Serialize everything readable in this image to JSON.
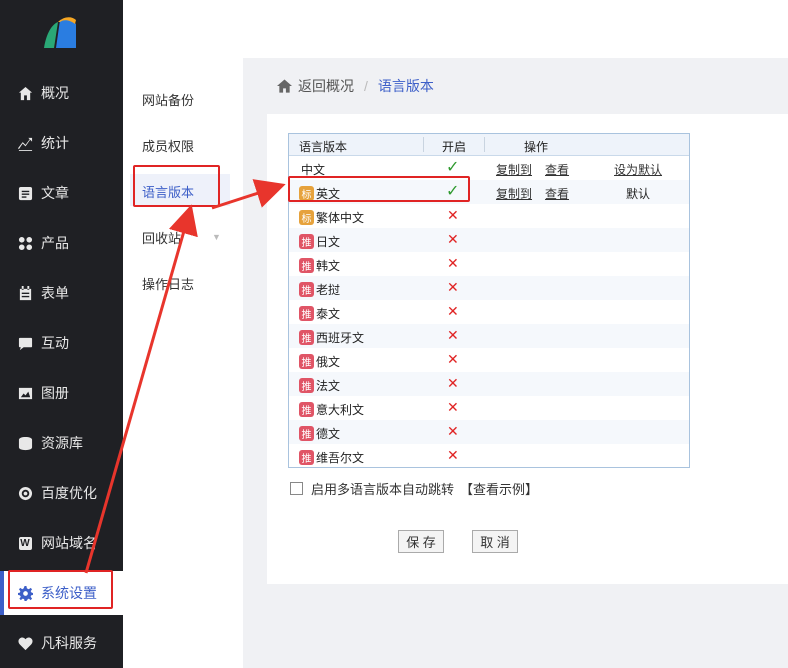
{
  "sidebar": {
    "items": [
      {
        "label": "概况",
        "icon": "home-icon"
      },
      {
        "label": "统计",
        "icon": "chart-icon"
      },
      {
        "label": "文章",
        "icon": "article-icon"
      },
      {
        "label": "产品",
        "icon": "grid-icon"
      },
      {
        "label": "表单",
        "icon": "calendar-icon"
      },
      {
        "label": "互动",
        "icon": "chat-icon"
      },
      {
        "label": "图册",
        "icon": "image-icon"
      },
      {
        "label": "资源库",
        "icon": "database-icon"
      },
      {
        "label": "百度优化",
        "icon": "target-icon"
      },
      {
        "label": "网站域名",
        "icon": "w-icon"
      },
      {
        "label": "系统设置",
        "icon": "gear-icon"
      },
      {
        "label": "凡科服务",
        "icon": "heart-icon"
      }
    ]
  },
  "subnav": {
    "items": [
      "网站备份",
      "成员权限",
      "语言版本",
      "回收站",
      "操作日志"
    ]
  },
  "breadcrumb": {
    "back": "返回概况",
    "separator": "/",
    "current": "语言版本"
  },
  "table": {
    "headers": [
      "语言版本",
      "开启",
      "操作"
    ],
    "rows": [
      {
        "name": "中文",
        "badge": "",
        "enabled": true,
        "copy": "复制到",
        "view": "查看",
        "default": "设为默认",
        "default_link": true
      },
      {
        "name": "英文",
        "badge": "标",
        "enabled": true,
        "copy": "复制到",
        "view": "查看",
        "default": "默认",
        "default_link": false
      },
      {
        "name": "繁体中文",
        "badge": "标",
        "enabled": false
      },
      {
        "name": "日文",
        "badge": "推",
        "enabled": false
      },
      {
        "name": "韩文",
        "badge": "推",
        "enabled": false
      },
      {
        "name": "老挝",
        "badge": "推",
        "enabled": false
      },
      {
        "name": "泰文",
        "badge": "推",
        "enabled": false
      },
      {
        "name": "西班牙文",
        "badge": "推",
        "enabled": false
      },
      {
        "name": "俄文",
        "badge": "推",
        "enabled": false
      },
      {
        "name": "法文",
        "badge": "推",
        "enabled": false
      },
      {
        "name": "意大利文",
        "badge": "推",
        "enabled": false
      },
      {
        "name": "德文",
        "badge": "推",
        "enabled": false
      },
      {
        "name": "维吾尔文",
        "badge": "推",
        "enabled": false
      }
    ]
  },
  "auto_jump": {
    "label": "启用多语言版本自动跳转",
    "example": "【查看示例】",
    "checked": false
  },
  "buttons": {
    "save": "保 存",
    "cancel": "取 消"
  },
  "symbols": {
    "check": "✓",
    "cross": "✕"
  },
  "colors": {
    "accent": "#3d5fc8",
    "sidebar_bg": "#1f2024",
    "highlight": "#e02424",
    "check": "#2f9a2f"
  }
}
